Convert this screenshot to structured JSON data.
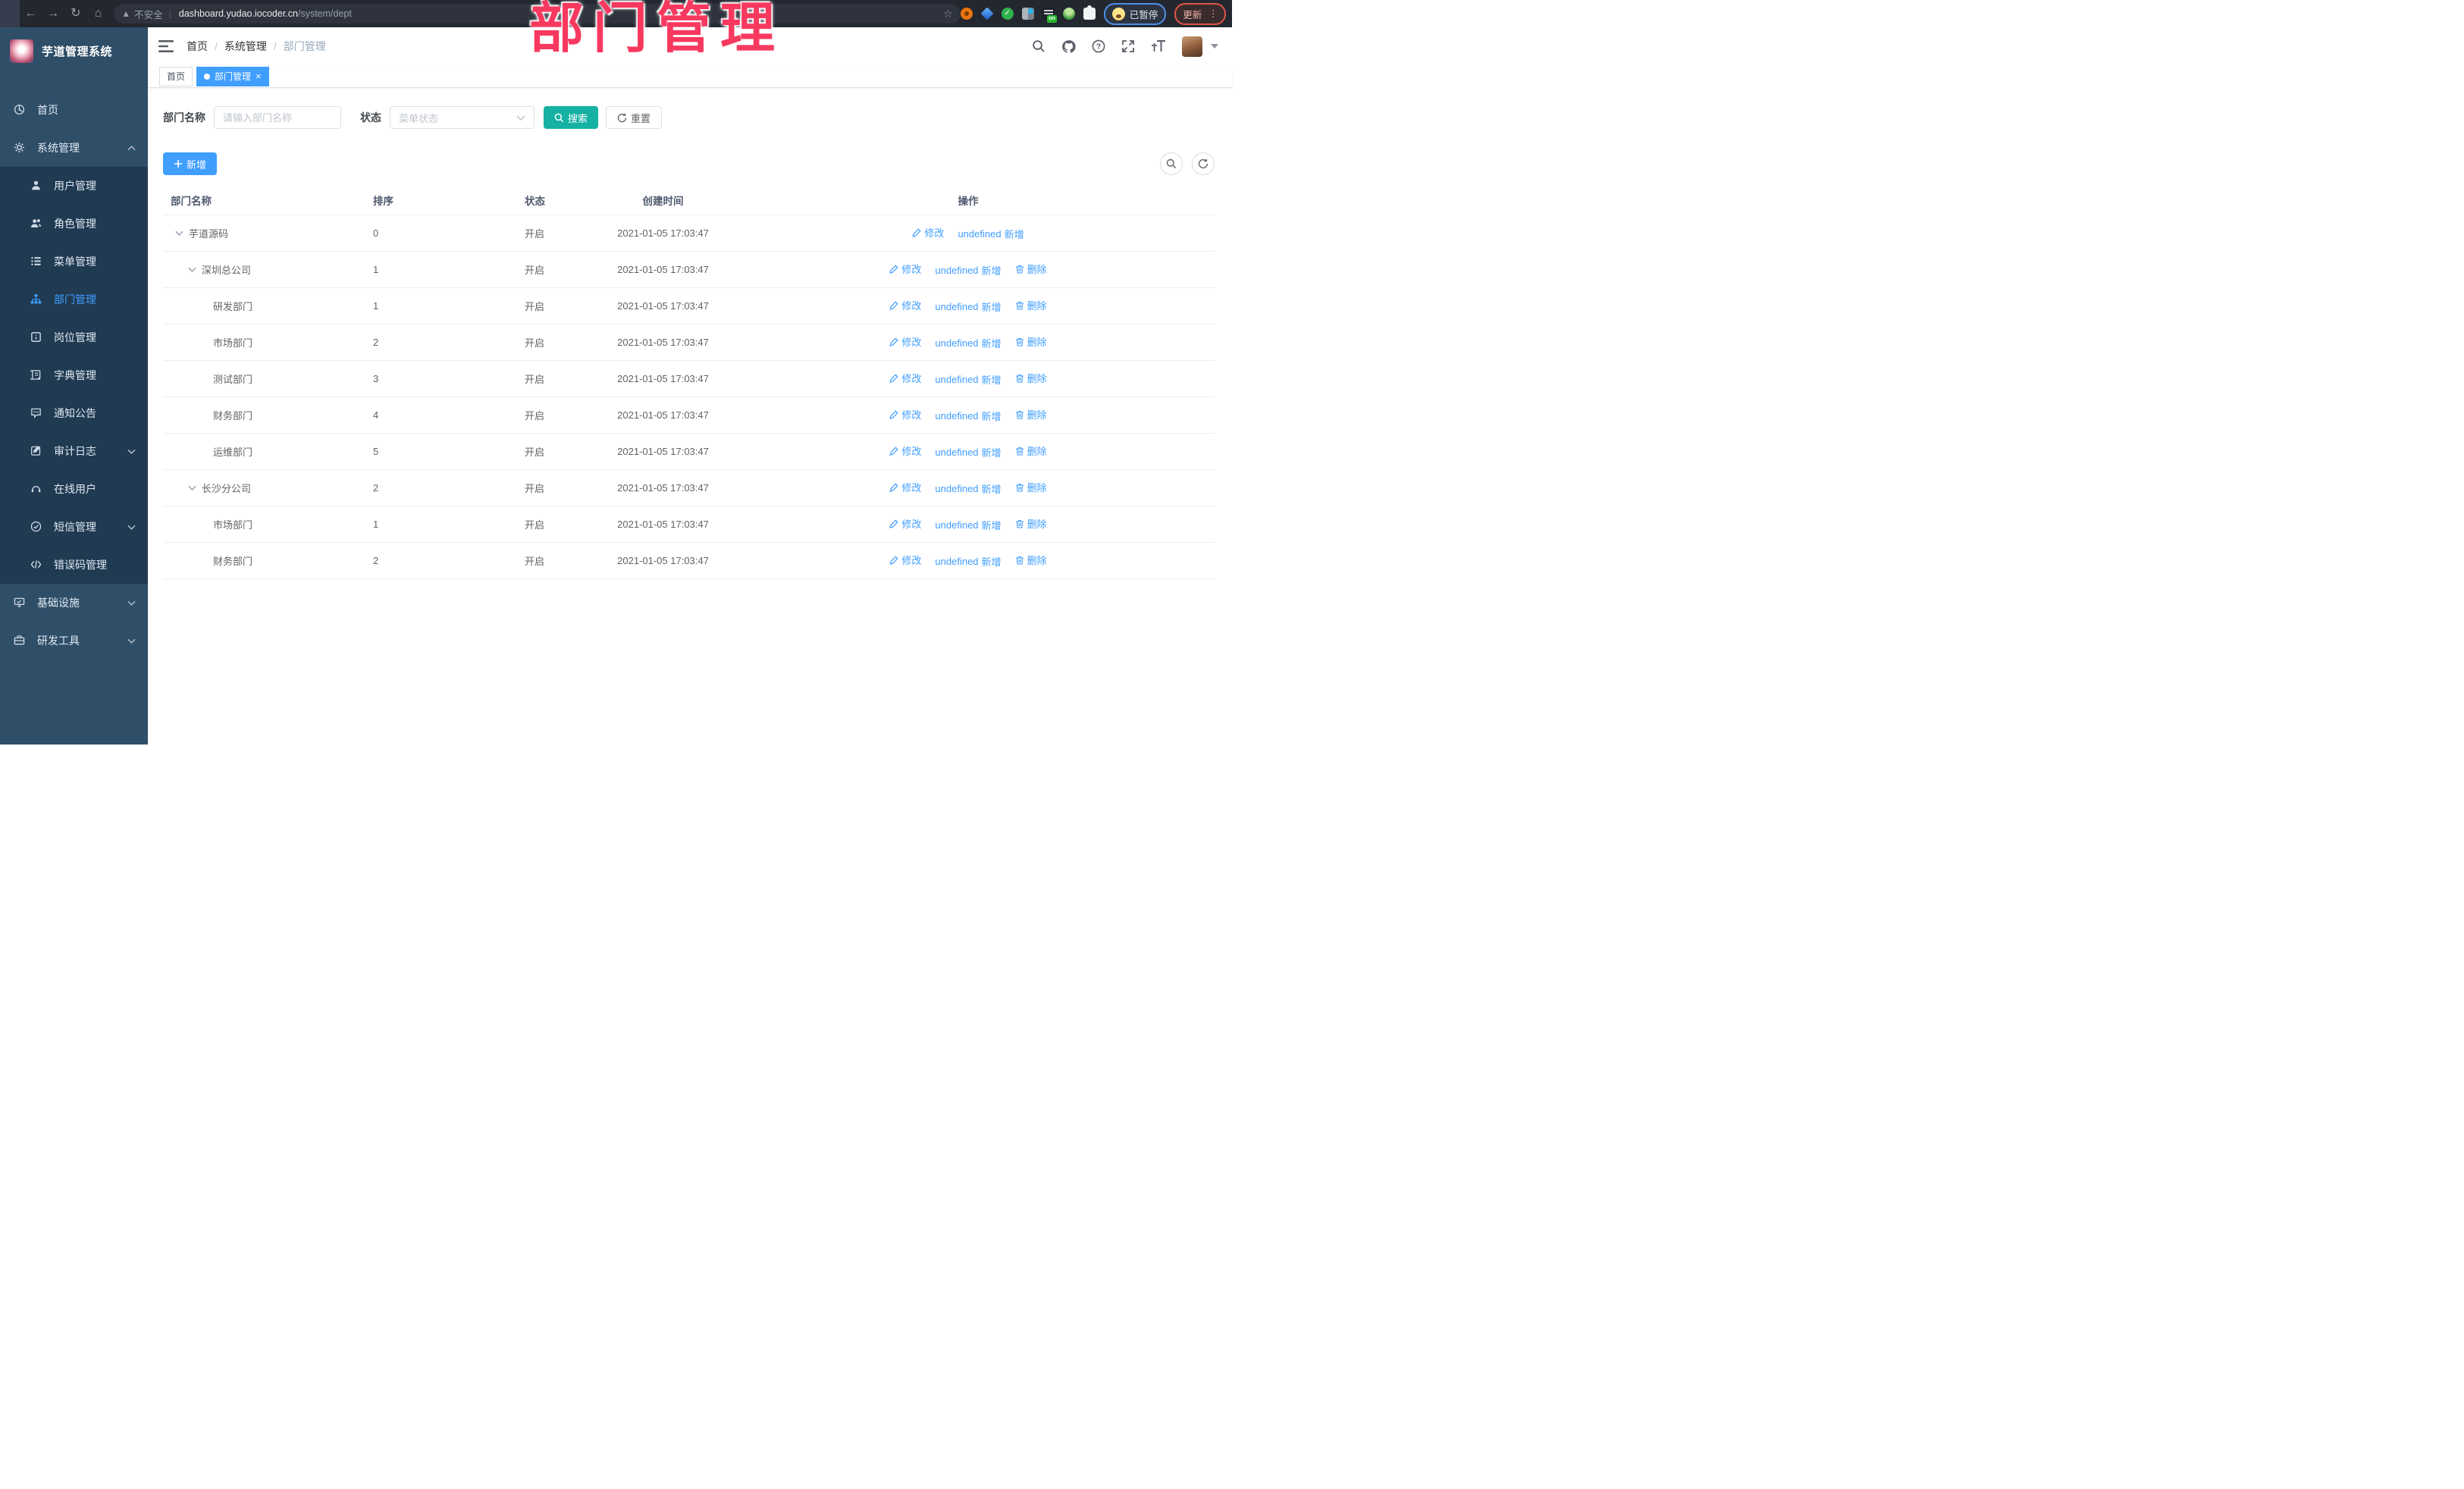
{
  "browser": {
    "back_icon": "back-arrow",
    "forward_icon": "forward-arrow",
    "reload_icon": "reload",
    "home_icon": "home",
    "security_label": "不安全",
    "url_host": "dashboard.yudao.iocoder.cn",
    "url_path": "/system/dept",
    "bookmark_icon": "star",
    "extensions": [
      "extension-orange-ring",
      "extension-blue-gem",
      "extension-green-check",
      "extension-grid-drop",
      "extension-list-on",
      "extension-green-person",
      "extension-puzzle"
    ],
    "paused_chip": "已暂停",
    "update_chip": "更新"
  },
  "watermark": "部门管理",
  "sidebar": {
    "title": "芋道管理系统",
    "items": [
      {
        "label": "首页",
        "icon": "dashboard-icon",
        "level": 0,
        "active": false,
        "caret": ""
      },
      {
        "label": "系统管理",
        "icon": "gear-icon",
        "level": 0,
        "active": false,
        "caret": "up"
      },
      {
        "label": "用户管理",
        "icon": "user-icon",
        "level": 1,
        "active": false,
        "caret": ""
      },
      {
        "label": "角色管理",
        "icon": "users-icon",
        "level": 1,
        "active": false,
        "caret": ""
      },
      {
        "label": "菜单管理",
        "icon": "menu-list-icon",
        "level": 1,
        "active": false,
        "caret": ""
      },
      {
        "label": "部门管理",
        "icon": "org-tree-icon",
        "level": 1,
        "active": true,
        "caret": ""
      },
      {
        "label": "岗位管理",
        "icon": "position-icon",
        "level": 1,
        "active": false,
        "caret": ""
      },
      {
        "label": "字典管理",
        "icon": "dictionary-icon",
        "level": 1,
        "active": false,
        "caret": ""
      },
      {
        "label": "通知公告",
        "icon": "announcement-icon",
        "level": 1,
        "active": false,
        "caret": ""
      },
      {
        "label": "审计日志",
        "icon": "audit-log-icon",
        "level": 1,
        "active": false,
        "caret": "down"
      },
      {
        "label": "在线用户",
        "icon": "online-user-icon",
        "level": 1,
        "active": false,
        "caret": ""
      },
      {
        "label": "短信管理",
        "icon": "sms-icon",
        "level": 1,
        "active": false,
        "caret": "down"
      },
      {
        "label": "错误码管理",
        "icon": "error-code-icon",
        "level": 1,
        "active": false,
        "caret": ""
      },
      {
        "label": "基础设施",
        "icon": "infrastructure-icon",
        "level": 0,
        "active": false,
        "caret": "down"
      },
      {
        "label": "研发工具",
        "icon": "dev-tools-icon",
        "level": 0,
        "active": false,
        "caret": "down"
      }
    ]
  },
  "topbar": {
    "breadcrumb": [
      "首页",
      "系统管理",
      "部门管理"
    ],
    "icons": [
      "search-icon",
      "github-icon",
      "help-icon",
      "fullscreen-icon",
      "font-size-icon"
    ]
  },
  "tabs": [
    {
      "label": "首页",
      "active": false,
      "closable": false
    },
    {
      "label": "部门管理",
      "active": true,
      "closable": true
    }
  ],
  "filters": {
    "name_label": "部门名称",
    "name_placeholder": "请输入部门名称",
    "name_value": "",
    "status_label": "状态",
    "status_placeholder": "菜单状态",
    "search_label": "搜索",
    "reset_label": "重置"
  },
  "toolbar": {
    "add_label": "新增"
  },
  "table": {
    "columns": [
      "部门名称",
      "排序",
      "状态",
      "创建时间",
      "操作"
    ],
    "action_labels": {
      "edit": "修改",
      "add": "新增",
      "delete": "删除"
    },
    "rows": [
      {
        "name": "芋道源码",
        "level": 0,
        "expandable": true,
        "sort": "0",
        "status": "开启",
        "time": "2021-01-05 17:03:47",
        "actions": [
          "edit",
          "add"
        ]
      },
      {
        "name": "深圳总公司",
        "level": 1,
        "expandable": true,
        "sort": "1",
        "status": "开启",
        "time": "2021-01-05 17:03:47",
        "actions": [
          "edit",
          "add",
          "delete"
        ]
      },
      {
        "name": "研发部门",
        "level": 2,
        "expandable": false,
        "sort": "1",
        "status": "开启",
        "time": "2021-01-05 17:03:47",
        "actions": [
          "edit",
          "add",
          "delete"
        ]
      },
      {
        "name": "市场部门",
        "level": 2,
        "expandable": false,
        "sort": "2",
        "status": "开启",
        "time": "2021-01-05 17:03:47",
        "actions": [
          "edit",
          "add",
          "delete"
        ]
      },
      {
        "name": "测试部门",
        "level": 2,
        "expandable": false,
        "sort": "3",
        "status": "开启",
        "time": "2021-01-05 17:03:47",
        "actions": [
          "edit",
          "add",
          "delete"
        ]
      },
      {
        "name": "财务部门",
        "level": 2,
        "expandable": false,
        "sort": "4",
        "status": "开启",
        "time": "2021-01-05 17:03:47",
        "actions": [
          "edit",
          "add",
          "delete"
        ]
      },
      {
        "name": "运维部门",
        "level": 2,
        "expandable": false,
        "sort": "5",
        "status": "开启",
        "time": "2021-01-05 17:03:47",
        "actions": [
          "edit",
          "add",
          "delete"
        ]
      },
      {
        "name": "长沙分公司",
        "level": 1,
        "expandable": true,
        "sort": "2",
        "status": "开启",
        "time": "2021-01-05 17:03:47",
        "actions": [
          "edit",
          "add",
          "delete"
        ]
      },
      {
        "name": "市场部门",
        "level": 2,
        "expandable": false,
        "sort": "1",
        "status": "开启",
        "time": "2021-01-05 17:03:47",
        "actions": [
          "edit",
          "add",
          "delete"
        ]
      },
      {
        "name": "财务部门",
        "level": 2,
        "expandable": false,
        "sort": "2",
        "status": "开启",
        "time": "2021-01-05 17:03:47",
        "actions": [
          "edit",
          "add",
          "delete"
        ]
      }
    ]
  },
  "colors": {
    "accent": "#409eff",
    "search_button": "#15b1a2",
    "watermark": "#f8395f",
    "sidebar_bg": "#2f4e68",
    "submenu_bg": "#203a52",
    "active_tab": "#409eff"
  }
}
